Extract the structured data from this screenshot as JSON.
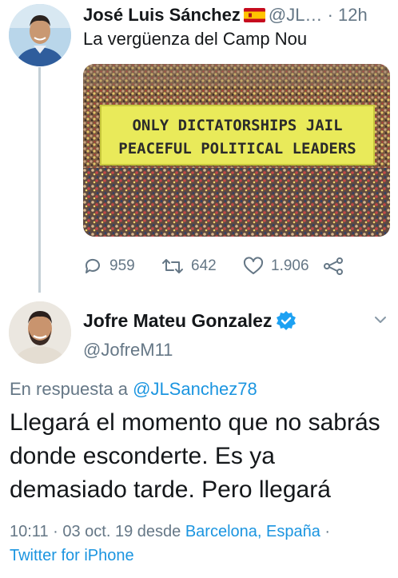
{
  "tweet1": {
    "name": "José Luis Sánchez",
    "flag_icon": "spain-flag-icon",
    "handle": "@JL…",
    "separator": "·",
    "time": "12h",
    "text": "La vergüenza del Camp Nou",
    "media": {
      "banner_line1": "ONLY DICTATORSHIPS JAIL",
      "banner_line2": "PEACEFUL POLITICAL LEADERS"
    },
    "actions": {
      "replies": "959",
      "retweets": "642",
      "likes": "1.906"
    }
  },
  "tweet2": {
    "name": "Jofre Mateu Gonzalez",
    "handle": "@JofreM11",
    "reply_prefix": "En respuesta a",
    "reply_handle": "@JLSanchez78",
    "text": "Llegará el momento que no sabrás donde esconderte. Es ya demasiado tarde. Pero llegará",
    "time": "10:11",
    "date": "03 oct. 19",
    "from_word": "desde",
    "location": "Barcelona, España",
    "client": "Twitter for iPhone"
  },
  "colors": {
    "link": "#1b95e0",
    "muted": "#657786",
    "text": "#14171a",
    "banner": "#e9ea5a"
  }
}
